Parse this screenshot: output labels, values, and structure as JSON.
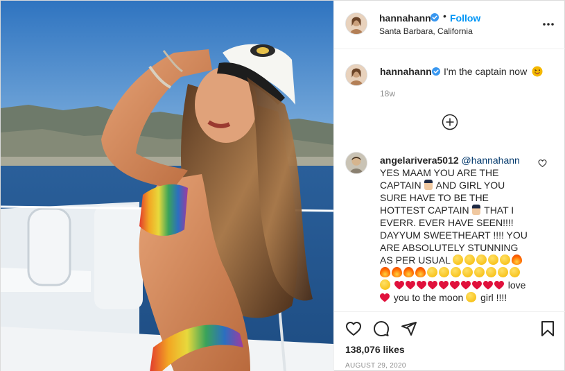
{
  "header": {
    "username": "hannahann",
    "follow_label": "Follow",
    "separator": "•",
    "location": "Santa Barbara, California"
  },
  "caption": {
    "username": "hannahann",
    "text": "I'm the captain now",
    "emoji_icon": "tongue-out-emoji",
    "time": "18w"
  },
  "comment": {
    "username": "angelarivera5012",
    "mention": "@hannahann",
    "text_1": "YES MAAM YOU ARE THE CAPTAIN",
    "text_2": "AND GIRL YOU SURE HAVE TO BE THE HOTTEST CAPTAIN",
    "text_3": "THAT I EVERR. EVER HAVE SEEN!!!! DAYYUM SWEETHEART !!!! YOU ARE ABSOLUTELY STUNNING AS PER USUAL",
    "text_4": "love",
    "text_5": "you to the moon",
    "text_6": "girl !!!!"
  },
  "actions": {
    "likes_count": "138,076",
    "likes_label": "likes",
    "date": "AUGUST 29, 2020"
  },
  "colors": {
    "follow_blue": "#0095f6",
    "verified_blue": "#3897f0",
    "heart_red": "#e0113c"
  }
}
